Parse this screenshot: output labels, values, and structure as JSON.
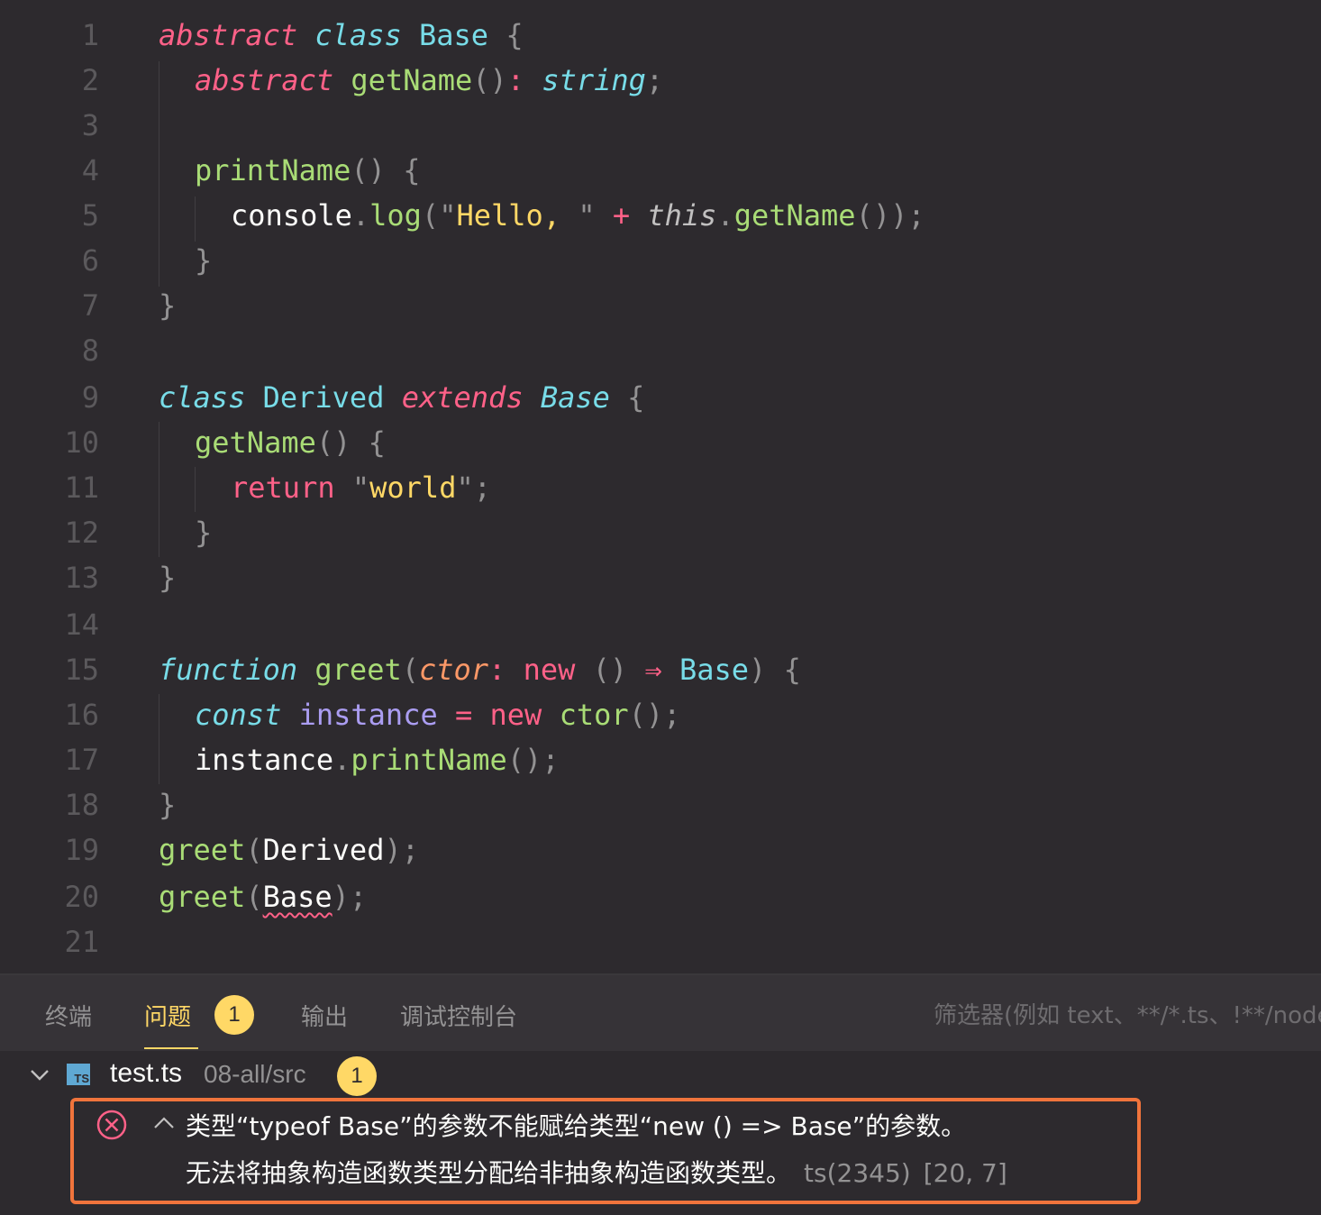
{
  "editor": {
    "lines": [
      {
        "n": "1"
      },
      {
        "n": "2"
      },
      {
        "n": "3"
      },
      {
        "n": "4"
      },
      {
        "n": "5"
      },
      {
        "n": "6"
      },
      {
        "n": "7"
      },
      {
        "n": "8"
      },
      {
        "n": "9"
      },
      {
        "n": "10"
      },
      {
        "n": "11"
      },
      {
        "n": "12"
      },
      {
        "n": "13"
      },
      {
        "n": "14"
      },
      {
        "n": "15"
      },
      {
        "n": "16"
      },
      {
        "n": "17"
      },
      {
        "n": "18"
      },
      {
        "n": "19"
      },
      {
        "n": "20"
      },
      {
        "n": "21"
      }
    ],
    "code": {
      "l1": [
        "abstract",
        " ",
        "class",
        " ",
        "Base",
        " ",
        "{"
      ],
      "l2": [
        "abstract",
        " ",
        "getName",
        "()",
        ":",
        " ",
        "string",
        ";"
      ],
      "l4": [
        "printName",
        "()",
        " ",
        "{"
      ],
      "l5": [
        "console",
        ".",
        "log",
        "(",
        "\"",
        "Hello, ",
        "\"",
        " ",
        "+",
        " ",
        "this",
        ".",
        "getName",
        "())",
        ";"
      ],
      "l6": [
        "}"
      ],
      "l7": [
        "}"
      ],
      "l9": [
        "class",
        " ",
        "Derived",
        " ",
        "extends",
        " ",
        "Base",
        " ",
        "{"
      ],
      "l10": [
        "getName",
        "()",
        " ",
        "{"
      ],
      "l11": [
        "return",
        " ",
        "\"",
        "world",
        "\"",
        ";"
      ],
      "l12": [
        "}"
      ],
      "l13": [
        "}"
      ],
      "l15": [
        "function",
        " ",
        "greet",
        "(",
        "ctor",
        ":",
        " ",
        "new",
        " ",
        "()",
        " ",
        "⇒",
        " ",
        "Base",
        ")",
        " ",
        "{"
      ],
      "l16": [
        "const",
        " ",
        "instance",
        " ",
        "=",
        " ",
        "new",
        " ",
        "ctor",
        "()",
        ";"
      ],
      "l17": [
        "instance",
        ".",
        "printName",
        "()",
        ";"
      ],
      "l18": [
        "}"
      ],
      "l19": [
        "greet",
        "(",
        "Derived",
        ")",
        ";"
      ],
      "l20": [
        "greet",
        "(",
        "Base",
        ")",
        ";"
      ]
    }
  },
  "panel": {
    "tabs": [
      {
        "label": "终端"
      },
      {
        "label": "问题"
      },
      {
        "label": "输出"
      },
      {
        "label": "调试控制台"
      }
    ],
    "problems_count": "1",
    "filter_placeholder": "筛选器(例如 text、**/*.ts、!**/node_modules/**)",
    "file": {
      "icon": "TS",
      "name": "test.ts",
      "path": "08-all/src",
      "count": "1"
    },
    "error": {
      "line1": "类型“typeof Base”的参数不能赋给类型“new () => Base”的参数。",
      "line2": "无法将抽象构造函数类型分配给非抽象构造函数类型。",
      "code": "ts(2345)",
      "position": "[20, 7]"
    },
    "colors": {
      "accent": "#ffd866",
      "error": "#ff6188",
      "highlight_border": "#f0743c"
    }
  }
}
